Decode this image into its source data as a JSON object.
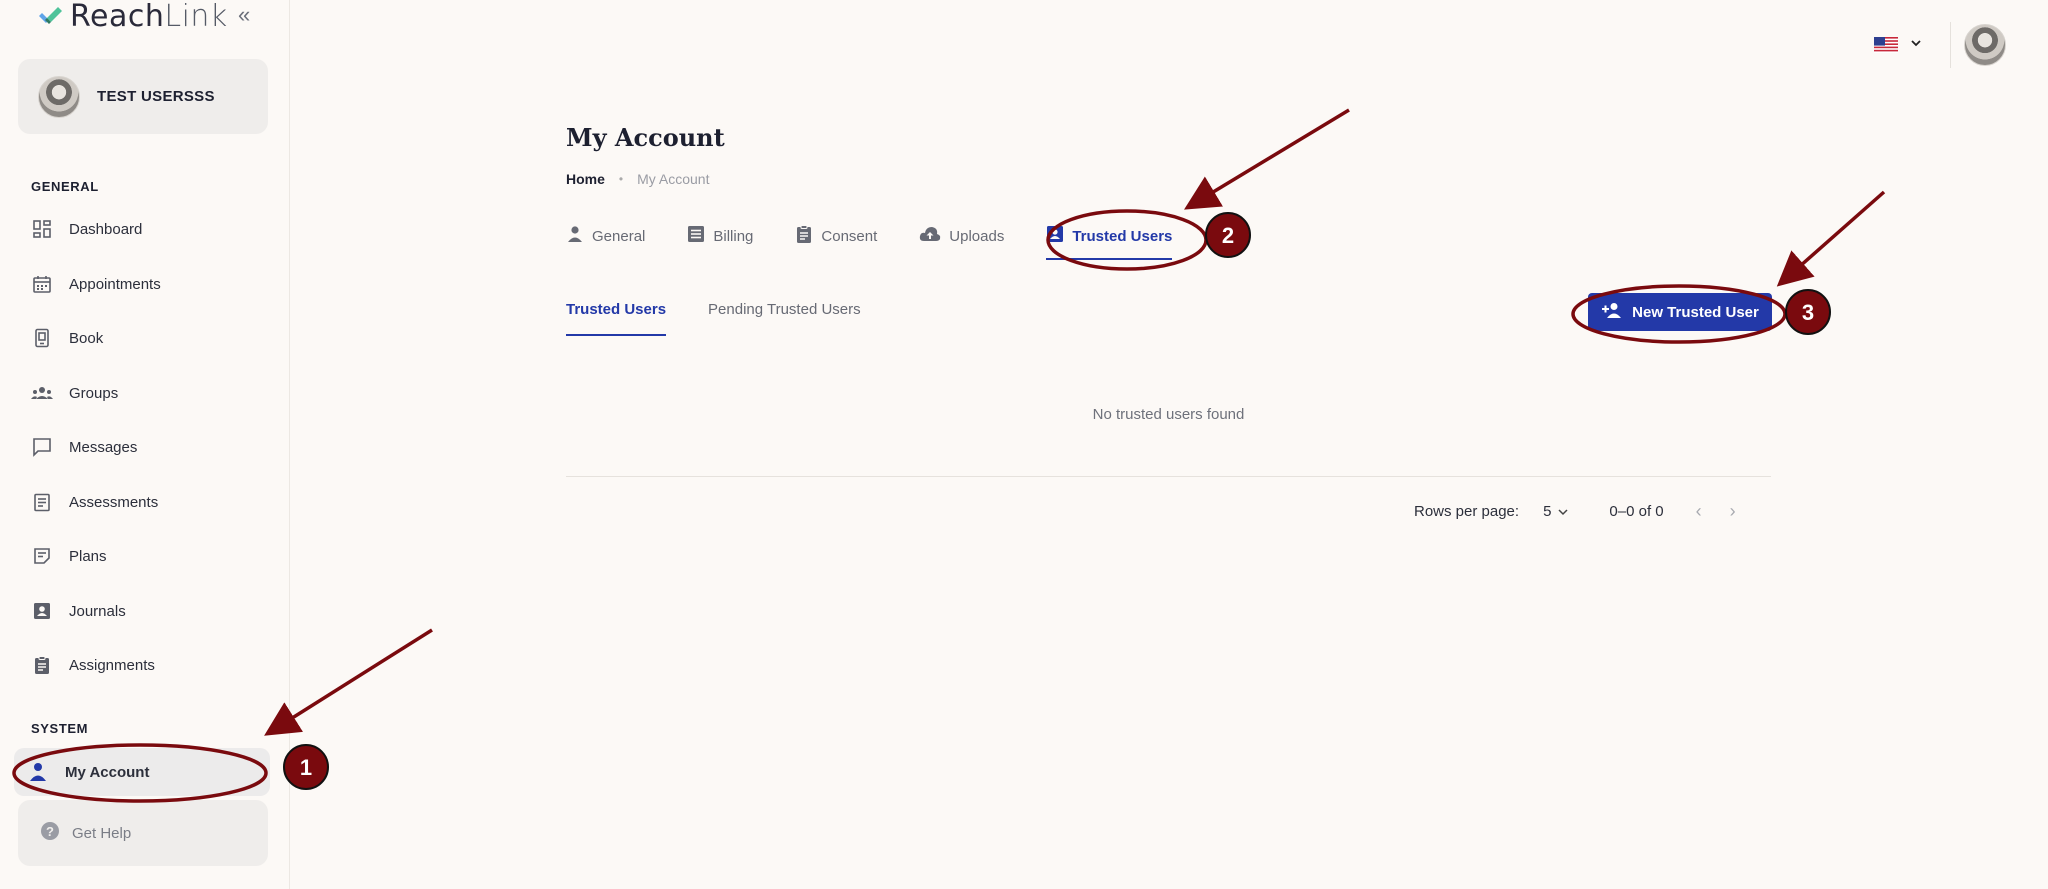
{
  "app": {
    "logo_main": "Reach",
    "logo_light": "Link"
  },
  "sidebar": {
    "user_name": "TEST USERSSS",
    "general_label": "GENERAL",
    "system_label": "SYSTEM",
    "items": [
      {
        "label": "Dashboard",
        "icon": "dashboard-icon"
      },
      {
        "label": "Appointments",
        "icon": "calendar-icon"
      },
      {
        "label": "Book",
        "icon": "book-icon"
      },
      {
        "label": "Groups",
        "icon": "groups-icon"
      },
      {
        "label": "Messages",
        "icon": "message-icon"
      },
      {
        "label": "Assessments",
        "icon": "assessment-icon"
      },
      {
        "label": "Plans",
        "icon": "plans-icon"
      },
      {
        "label": "Journals",
        "icon": "journal-icon"
      },
      {
        "label": "Assignments",
        "icon": "assignment-icon"
      }
    ],
    "my_account": "My Account",
    "get_help": "Get Help"
  },
  "header": {
    "language_flag": "us-flag-icon"
  },
  "main": {
    "title": "My Account",
    "breadcrumb_home": "Home",
    "breadcrumb_current": "My Account",
    "tabs": [
      {
        "label": "General",
        "icon": "person-icon"
      },
      {
        "label": "Billing",
        "icon": "billing-icon"
      },
      {
        "label": "Consent",
        "icon": "clipboard-icon"
      },
      {
        "label": "Uploads",
        "icon": "cloud-upload-icon"
      },
      {
        "label": "Trusted Users",
        "icon": "contact-card-icon",
        "active": true
      }
    ],
    "subtabs": [
      {
        "label": "Trusted Users",
        "active": true
      },
      {
        "label": "Pending Trusted Users"
      }
    ],
    "new_button": "New Trusted User",
    "empty_message": "No trusted users found",
    "rows_per_page_label": "Rows per page:",
    "rows_per_page_value": "5",
    "range": "0–0 of 0"
  },
  "annotations": {
    "step1": "1",
    "step2": "2",
    "step3": "3",
    "color": "#7a0a0e"
  },
  "colors": {
    "accent": "#2339a8",
    "background": "#fcf9f6"
  }
}
